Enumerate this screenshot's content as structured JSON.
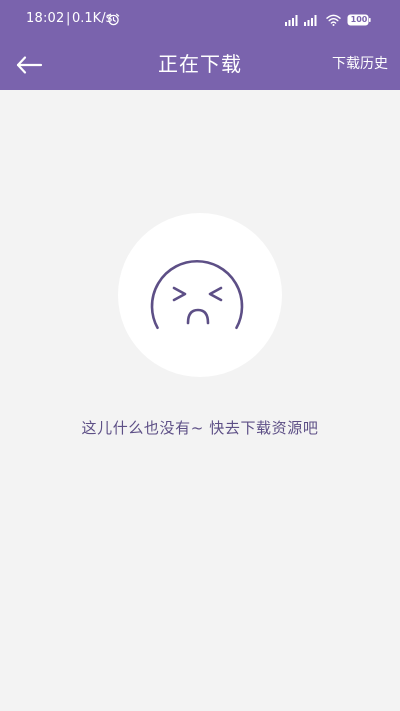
{
  "status_bar": {
    "time": "18:02",
    "separator": "|",
    "net_speed": "0.1K/s",
    "battery": "100"
  },
  "nav": {
    "title": "正在下载",
    "history_label": "下载历史"
  },
  "empty_state": {
    "message": "这儿什么也没有~ 快去下载资源吧"
  },
  "colors": {
    "header": "#7a63ad",
    "background": "#f3f3f3",
    "accent_text": "#5d4f86"
  }
}
